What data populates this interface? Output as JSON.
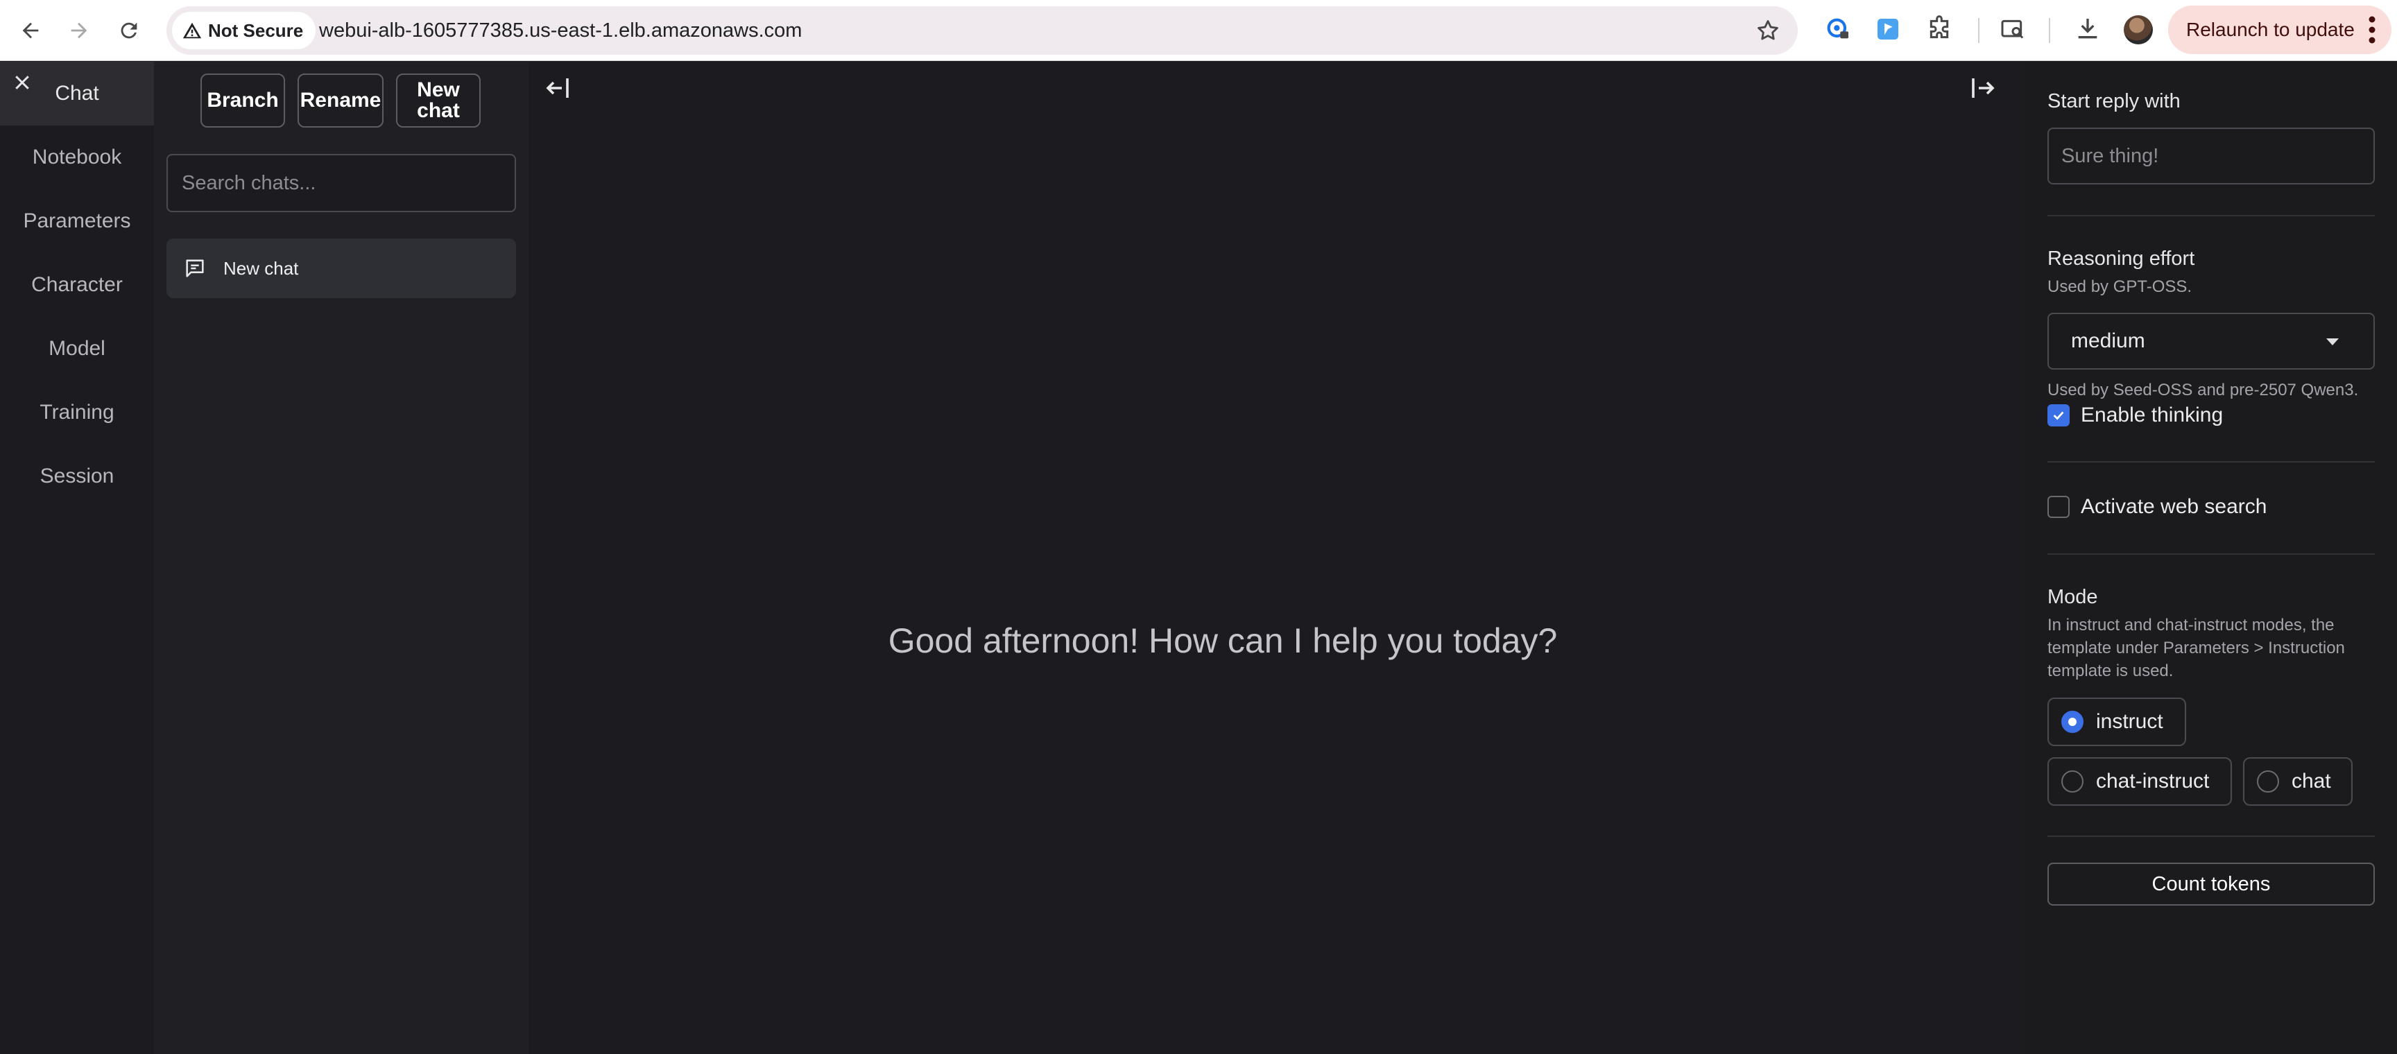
{
  "browser": {
    "security_label": "Not Secure",
    "url": "webui-alb-1605777385.us-east-1.elb.amazonaws.com",
    "relaunch_label": "Relaunch to update",
    "icons": [
      "back-icon",
      "forward-icon",
      "reload-icon",
      "warning-icon",
      "star-icon",
      "password-manager-icon",
      "extension-icon",
      "puzzle-icon",
      "tab-search-icon",
      "download-icon",
      "avatar"
    ]
  },
  "nav": {
    "items": [
      {
        "label": "Chat",
        "active": true
      },
      {
        "label": "Notebook"
      },
      {
        "label": "Parameters"
      },
      {
        "label": "Character"
      },
      {
        "label": "Model"
      },
      {
        "label": "Training"
      },
      {
        "label": "Session"
      }
    ]
  },
  "chat_panel": {
    "branch_label": "Branch",
    "rename_label": "Rename",
    "new_chat_label": "New chat",
    "search_placeholder": "Search chats...",
    "chats": [
      {
        "title": "New chat"
      }
    ]
  },
  "main": {
    "greeting": "Good afternoon! How can I help you today?"
  },
  "settings": {
    "start_reply_label": "Start reply with",
    "start_reply_placeholder": "Sure thing!",
    "reasoning_label": "Reasoning effort",
    "reasoning_help": "Used by GPT-OSS.",
    "reasoning_value": "medium",
    "thinking_help": "Used by Seed-OSS and pre-2507 Qwen3.",
    "thinking_label": "Enable thinking",
    "thinking_checked": true,
    "web_search_label": "Activate web search",
    "web_search_checked": false,
    "mode_label": "Mode",
    "mode_help": "In instruct and chat-instruct modes, the template under Parameters > Instruction template is used.",
    "modes": [
      {
        "label": "instruct",
        "selected": true
      },
      {
        "label": "chat-instruct",
        "selected": false
      },
      {
        "label": "chat",
        "selected": false
      }
    ],
    "count_tokens_label": "Count tokens"
  },
  "colors": {
    "background": "#1c1c20",
    "panel": "#202024",
    "accent": "#3b6fe6",
    "relaunch_bg": "#f9dedc"
  }
}
